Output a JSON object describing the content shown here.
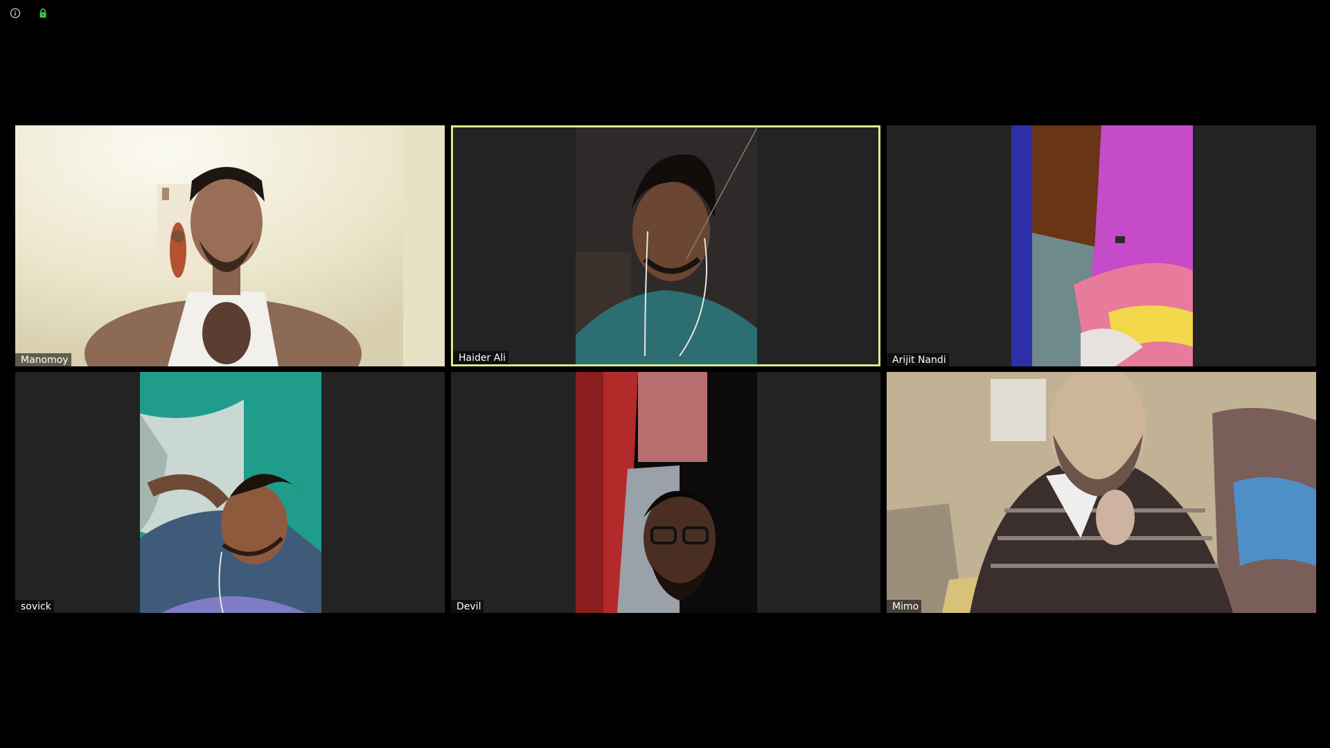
{
  "top_bar": {
    "info_icon": "info-icon",
    "lock_icon": "lock-icon",
    "lock_color": "#3fcf3f"
  },
  "gallery": {
    "active_speaker_border": "#dfe98a",
    "tiles": [
      {
        "name": "Manomoy",
        "active": false,
        "video": "full"
      },
      {
        "name": "Haider Ali",
        "active": true,
        "video": "portrait"
      },
      {
        "name": "Arijit Nandi",
        "active": false,
        "video": "portrait"
      },
      {
        "name": "sovick",
        "active": false,
        "video": "portrait"
      },
      {
        "name": "Devil",
        "active": false,
        "video": "portrait"
      },
      {
        "name": "Mimo",
        "active": false,
        "video": "full"
      }
    ]
  }
}
